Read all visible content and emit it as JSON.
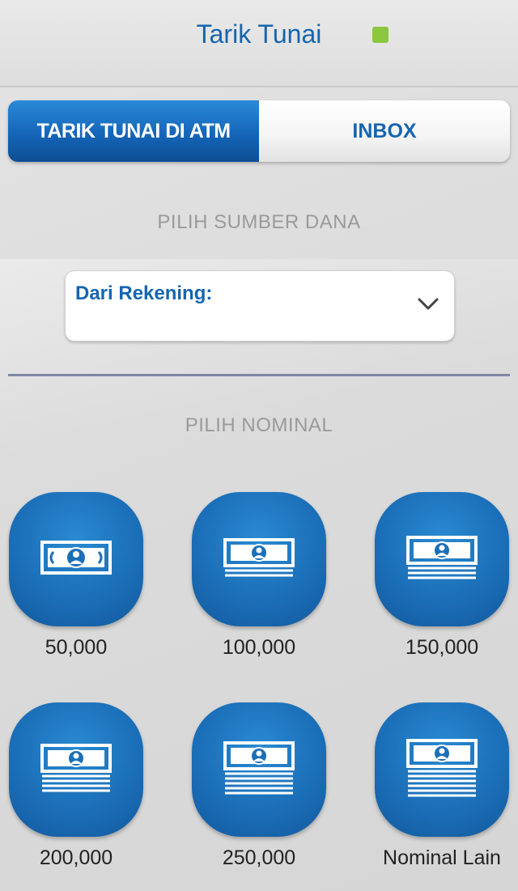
{
  "header": {
    "title": "Tarik Tunai",
    "status_color": "#8cc63f"
  },
  "tabs": [
    {
      "label": "TARIK TUNAI DI ATM",
      "active": true
    },
    {
      "label": "INBOX",
      "active": false
    }
  ],
  "source_section": {
    "label": "PILIH SUMBER DANA",
    "dropdown_label": "Dari Rekening:",
    "dropdown_value": ""
  },
  "nominal_section": {
    "label": "PILIH NOMINAL",
    "options": [
      {
        "label": "50,000",
        "icon": "single-banknote-icon"
      },
      {
        "label": "100,000",
        "icon": "banknote-stack-icon"
      },
      {
        "label": "150,000",
        "icon": "banknote-stack-icon"
      },
      {
        "label": "200,000",
        "icon": "banknote-stack-icon"
      },
      {
        "label": "250,000",
        "icon": "banknote-stack-icon"
      },
      {
        "label": "Nominal Lain",
        "icon": "banknote-stack-icon"
      }
    ]
  },
  "colors": {
    "brand_blue": "#1565b0",
    "button_blue": "#1b6fb8"
  }
}
